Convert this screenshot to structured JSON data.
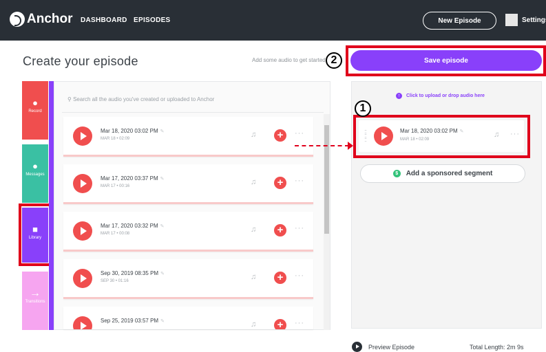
{
  "topbar": {
    "brand": "Anchor",
    "nav_dashboard": "DASHBOARD",
    "nav_episodes": "EPISODES",
    "new_episode": "New Episode",
    "settings": "Settings"
  },
  "page": {
    "title": "Create your episode",
    "hint": "Add some audio to get started",
    "save_button": "Save episode"
  },
  "annotations": {
    "step1": "1",
    "step2": "2"
  },
  "tools": [
    {
      "label": "Record",
      "icon": "microphone-icon",
      "color": "#f04e4e"
    },
    {
      "label": "Messages",
      "icon": "chat-bubble-icon",
      "color": "#3ac0a3"
    },
    {
      "label": "Library",
      "icon": "folder-icon",
      "color": "#8940fa"
    },
    {
      "label": "Transitions",
      "icon": "arrow-right-icon",
      "color": "#f6a5f0"
    }
  ],
  "library": {
    "search_placeholder": "Search all the audio you've created or uploaded to Anchor",
    "items": [
      {
        "title": "Mar 18, 2020 03:02 PM",
        "meta": "MAR 18 • 02:09"
      },
      {
        "title": "Mar 17, 2020 03:37 PM",
        "meta": "MAR 17 • 00:16"
      },
      {
        "title": "Mar 17, 2020 03:32 PM",
        "meta": "MAR 17 • 00:08"
      },
      {
        "title": "Sep 30, 2019 08:35 PM",
        "meta": "SEP 30 • 01:16"
      },
      {
        "title": "Sep 25, 2019 03:57 PM",
        "meta": ""
      }
    ]
  },
  "episode": {
    "upload_text": "Click to upload or drop audio here",
    "segment_title": "Mar 18, 2020 03:02 PM",
    "segment_meta": "MAR 18 • 02:09",
    "sponsored": "Add a sponsored segment"
  },
  "footer": {
    "preview": "Preview Episode",
    "total": "Total Length: 2m 9s"
  },
  "colors": {
    "accent": "#8940fa",
    "play": "#f04e4e",
    "highlight": "#e0001b",
    "topbar": "#292f36"
  }
}
